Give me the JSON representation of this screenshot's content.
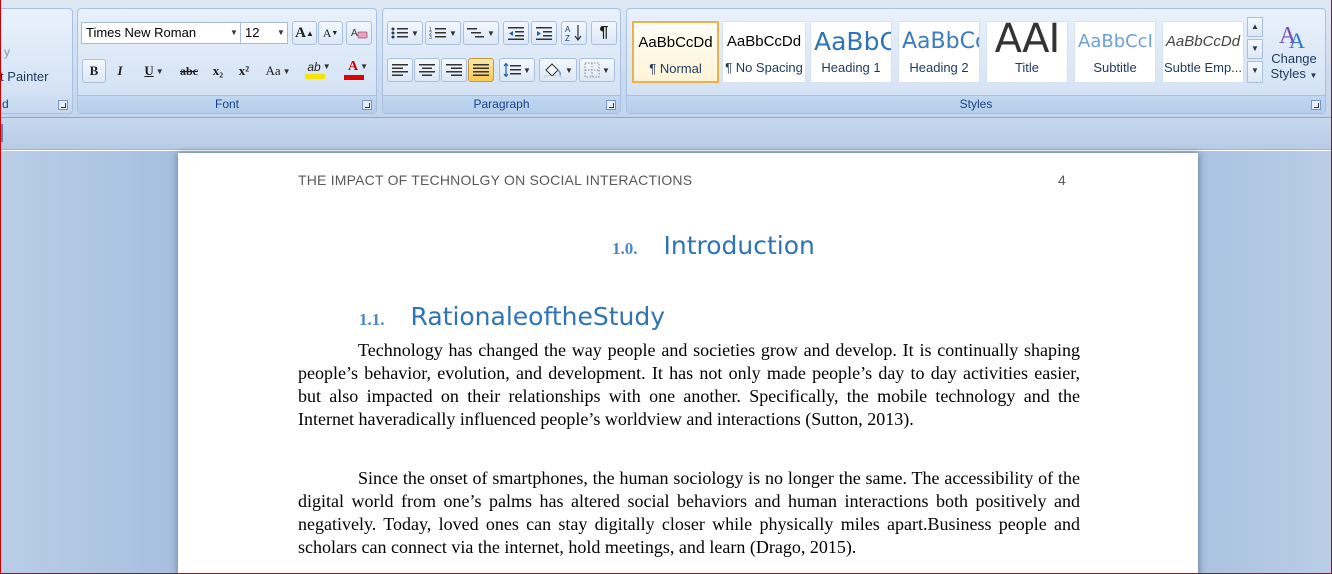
{
  "ribbon": {
    "clipboard": {
      "copy_fragment": "y",
      "format_painter_fragment": "mat Painter",
      "label_fragment": "d"
    },
    "font": {
      "label": "Font",
      "font_name": "Times New Roman",
      "font_size": "12",
      "grow_font": "A",
      "shrink_font": "A",
      "bold": "B",
      "italic": "I",
      "underline": "U",
      "strikethrough": "abc",
      "subscript": "x₂",
      "superscript": "x²",
      "change_case": "Aa",
      "highlight": "ab",
      "font_color": "A",
      "highlight_color": "#f5e400",
      "font_color_value": "#e00000"
    },
    "paragraph": {
      "label": "Paragraph"
    },
    "styles": {
      "label": "Styles",
      "items": [
        {
          "sample": "AaBbCcDd",
          "name": "¶ Normal"
        },
        {
          "sample": "AaBbCcDd",
          "name": "¶ No Spacing"
        },
        {
          "sample": "AaBbC",
          "name": "Heading 1"
        },
        {
          "sample": "AaBbCc",
          "name": "Heading 2"
        },
        {
          "sample": "AAI",
          "name": "Title"
        },
        {
          "sample": "AaBbCcI",
          "name": "Subtitle"
        },
        {
          "sample": "AaBbCcDd",
          "name": "Subtle Emp..."
        }
      ],
      "change_styles_line1": "Change",
      "change_styles_line2": "Styles"
    }
  },
  "document": {
    "running_header": "THE IMPACT OF TECHNOLGY ON SOCIAL INTERACTIONS",
    "page_number": "4",
    "heading1_number": "1.0.",
    "heading1_text": "Introduction",
    "heading2_number": "1.1.",
    "heading2_text": "RationaleoftheStudy",
    "paragraph1": "Technology has changed the way people and societies grow and develop. It is continually shaping people’s behavior, evolution, and development. It has not only made people’s day to day activities easier, but also impacted on their relationships with one another. Specifically, the mobile technology and the Internet haveradically influenced people’s worldview and interactions (Sutton, 2013).",
    "paragraph2": "Since the onset of smartphones, the human sociology is no longer the same. The accessibility of the digital world from one’s palms has altered social behaviors and human interactions both positively and negatively. Today, loved ones can stay digitally closer while physically miles apart.Business people and scholars can connect via the internet, hold meetings, and learn (Drago, 2015)."
  }
}
